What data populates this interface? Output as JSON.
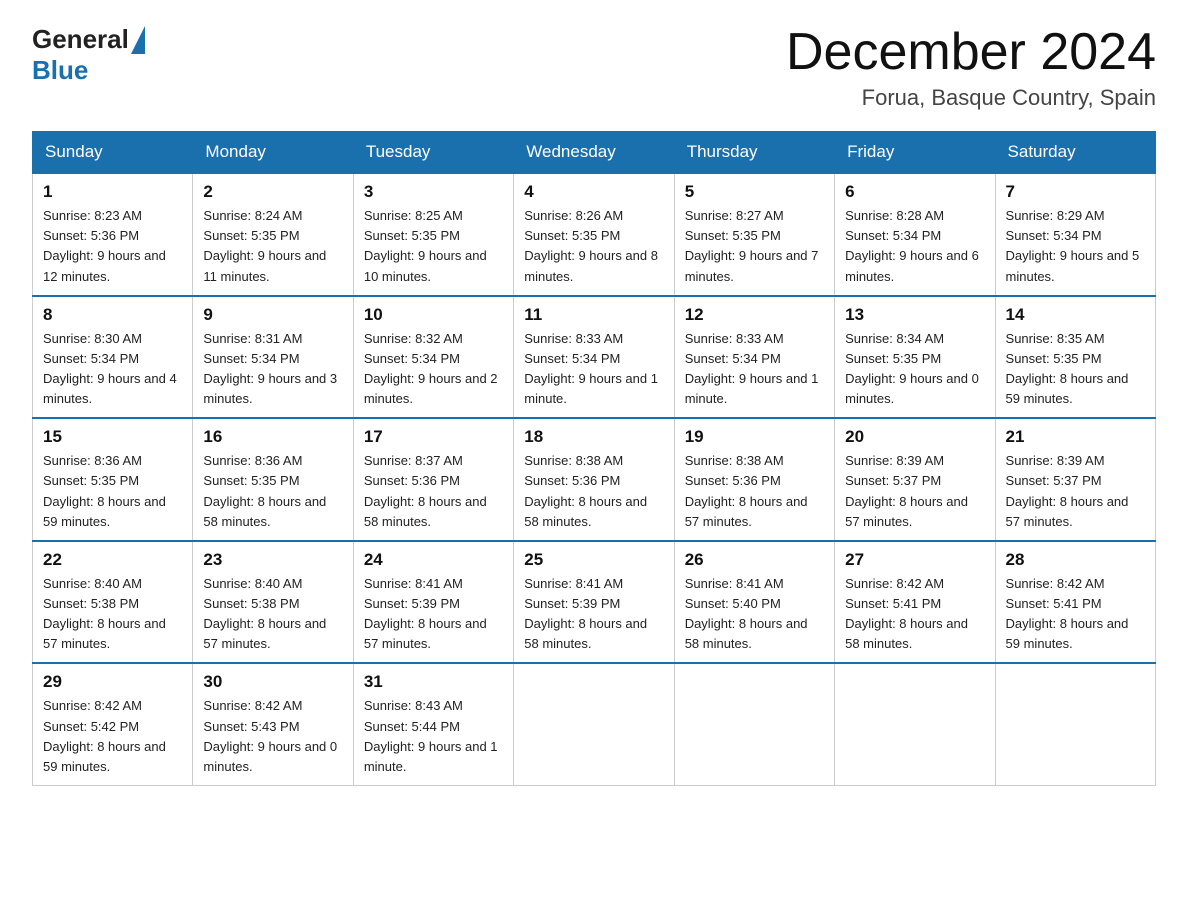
{
  "header": {
    "logo_general": "General",
    "logo_blue": "Blue",
    "title": "December 2024",
    "subtitle": "Forua, Basque Country, Spain"
  },
  "days_of_week": [
    "Sunday",
    "Monday",
    "Tuesday",
    "Wednesday",
    "Thursday",
    "Friday",
    "Saturday"
  ],
  "weeks": [
    [
      {
        "day": "1",
        "sunrise": "8:23 AM",
        "sunset": "5:36 PM",
        "daylight": "9 hours and 12 minutes."
      },
      {
        "day": "2",
        "sunrise": "8:24 AM",
        "sunset": "5:35 PM",
        "daylight": "9 hours and 11 minutes."
      },
      {
        "day": "3",
        "sunrise": "8:25 AM",
        "sunset": "5:35 PM",
        "daylight": "9 hours and 10 minutes."
      },
      {
        "day": "4",
        "sunrise": "8:26 AM",
        "sunset": "5:35 PM",
        "daylight": "9 hours and 8 minutes."
      },
      {
        "day": "5",
        "sunrise": "8:27 AM",
        "sunset": "5:35 PM",
        "daylight": "9 hours and 7 minutes."
      },
      {
        "day": "6",
        "sunrise": "8:28 AM",
        "sunset": "5:34 PM",
        "daylight": "9 hours and 6 minutes."
      },
      {
        "day": "7",
        "sunrise": "8:29 AM",
        "sunset": "5:34 PM",
        "daylight": "9 hours and 5 minutes."
      }
    ],
    [
      {
        "day": "8",
        "sunrise": "8:30 AM",
        "sunset": "5:34 PM",
        "daylight": "9 hours and 4 minutes."
      },
      {
        "day": "9",
        "sunrise": "8:31 AM",
        "sunset": "5:34 PM",
        "daylight": "9 hours and 3 minutes."
      },
      {
        "day": "10",
        "sunrise": "8:32 AM",
        "sunset": "5:34 PM",
        "daylight": "9 hours and 2 minutes."
      },
      {
        "day": "11",
        "sunrise": "8:33 AM",
        "sunset": "5:34 PM",
        "daylight": "9 hours and 1 minute."
      },
      {
        "day": "12",
        "sunrise": "8:33 AM",
        "sunset": "5:34 PM",
        "daylight": "9 hours and 1 minute."
      },
      {
        "day": "13",
        "sunrise": "8:34 AM",
        "sunset": "5:35 PM",
        "daylight": "9 hours and 0 minutes."
      },
      {
        "day": "14",
        "sunrise": "8:35 AM",
        "sunset": "5:35 PM",
        "daylight": "8 hours and 59 minutes."
      }
    ],
    [
      {
        "day": "15",
        "sunrise": "8:36 AM",
        "sunset": "5:35 PM",
        "daylight": "8 hours and 59 minutes."
      },
      {
        "day": "16",
        "sunrise": "8:36 AM",
        "sunset": "5:35 PM",
        "daylight": "8 hours and 58 minutes."
      },
      {
        "day": "17",
        "sunrise": "8:37 AM",
        "sunset": "5:36 PM",
        "daylight": "8 hours and 58 minutes."
      },
      {
        "day": "18",
        "sunrise": "8:38 AM",
        "sunset": "5:36 PM",
        "daylight": "8 hours and 58 minutes."
      },
      {
        "day": "19",
        "sunrise": "8:38 AM",
        "sunset": "5:36 PM",
        "daylight": "8 hours and 57 minutes."
      },
      {
        "day": "20",
        "sunrise": "8:39 AM",
        "sunset": "5:37 PM",
        "daylight": "8 hours and 57 minutes."
      },
      {
        "day": "21",
        "sunrise": "8:39 AM",
        "sunset": "5:37 PM",
        "daylight": "8 hours and 57 minutes."
      }
    ],
    [
      {
        "day": "22",
        "sunrise": "8:40 AM",
        "sunset": "5:38 PM",
        "daylight": "8 hours and 57 minutes."
      },
      {
        "day": "23",
        "sunrise": "8:40 AM",
        "sunset": "5:38 PM",
        "daylight": "8 hours and 57 minutes."
      },
      {
        "day": "24",
        "sunrise": "8:41 AM",
        "sunset": "5:39 PM",
        "daylight": "8 hours and 57 minutes."
      },
      {
        "day": "25",
        "sunrise": "8:41 AM",
        "sunset": "5:39 PM",
        "daylight": "8 hours and 58 minutes."
      },
      {
        "day": "26",
        "sunrise": "8:41 AM",
        "sunset": "5:40 PM",
        "daylight": "8 hours and 58 minutes."
      },
      {
        "day": "27",
        "sunrise": "8:42 AM",
        "sunset": "5:41 PM",
        "daylight": "8 hours and 58 minutes."
      },
      {
        "day": "28",
        "sunrise": "8:42 AM",
        "sunset": "5:41 PM",
        "daylight": "8 hours and 59 minutes."
      }
    ],
    [
      {
        "day": "29",
        "sunrise": "8:42 AM",
        "sunset": "5:42 PM",
        "daylight": "8 hours and 59 minutes."
      },
      {
        "day": "30",
        "sunrise": "8:42 AM",
        "sunset": "5:43 PM",
        "daylight": "9 hours and 0 minutes."
      },
      {
        "day": "31",
        "sunrise": "8:43 AM",
        "sunset": "5:44 PM",
        "daylight": "9 hours and 1 minute."
      },
      null,
      null,
      null,
      null
    ]
  ]
}
